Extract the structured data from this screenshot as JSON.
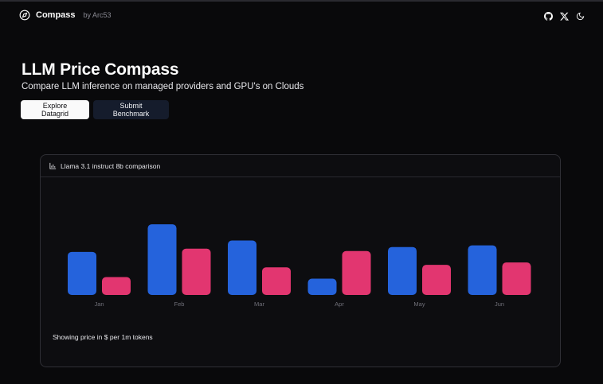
{
  "header": {
    "brand_name": "Compass",
    "brand_by": "by Arc53",
    "icons": [
      "github-icon",
      "x-icon",
      "theme-toggle-icon"
    ]
  },
  "hero": {
    "title": "LLM Price Compass",
    "subtitle": "Compare LLM inference on managed providers and GPU's on Clouds"
  },
  "actions": {
    "explore_label": "Explore Datagrid",
    "submit_label": "Submit Benchmark"
  },
  "card": {
    "title": "Llama 3.1 instruct 8b comparison",
    "footer": "Showing price in $ per 1m tokens"
  },
  "colors": {
    "background": "#09090b",
    "series_blue": "#2563dc",
    "series_pink": "#e23670",
    "secondary_button": "#151c2c"
  },
  "chart_data": {
    "type": "bar",
    "categories": [
      "Jan",
      "Feb",
      "Mar",
      "Apr",
      "May",
      "Jun"
    ],
    "series": [
      {
        "values": [
          53,
          87,
          67,
          20,
          59,
          61
        ],
        "color": "#2563dc"
      },
      {
        "values": [
          22,
          57,
          34,
          54,
          37,
          40
        ],
        "color": "#e23670"
      }
    ],
    "ylim": [
      0,
      90
    ],
    "grid": false,
    "legend": false
  }
}
